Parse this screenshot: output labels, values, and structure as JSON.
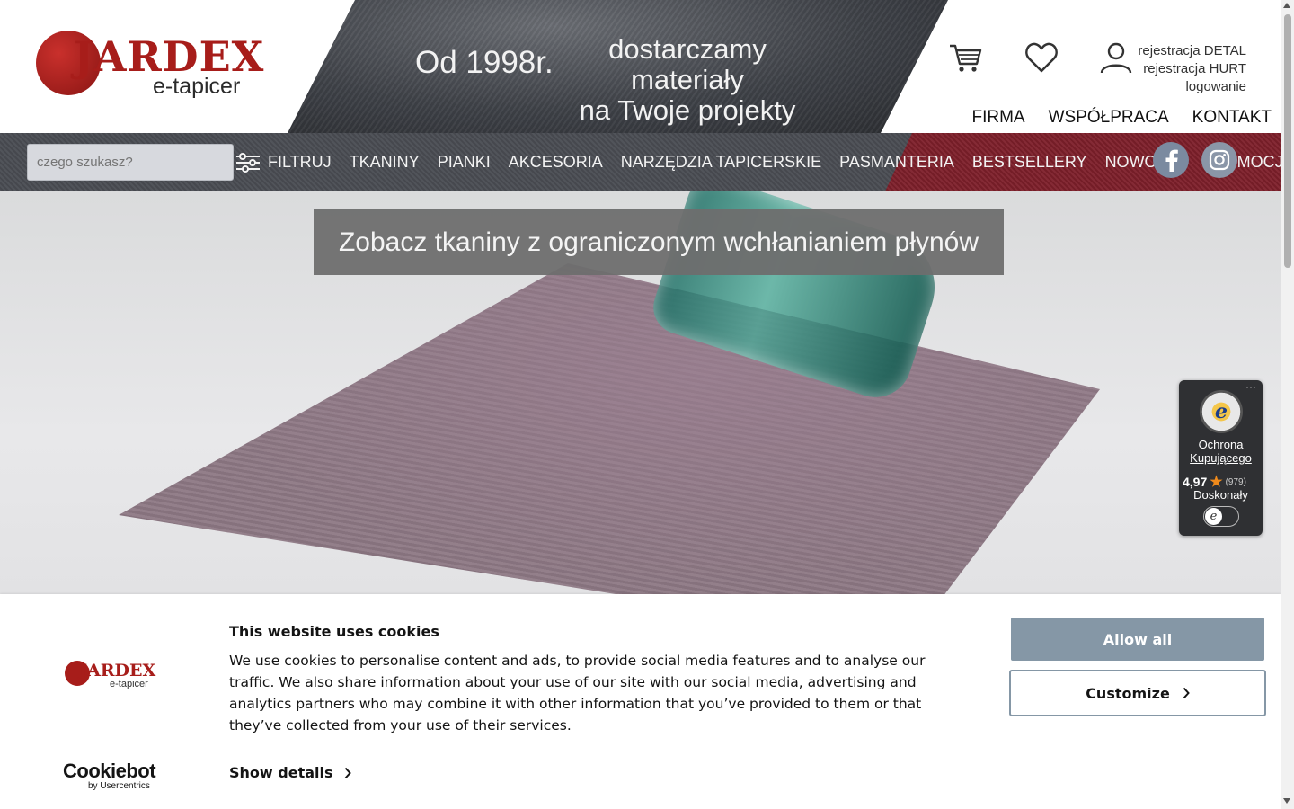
{
  "header": {
    "logo": {
      "word": "JARDEX",
      "sub": "e-tapicer"
    },
    "since": "Od 1998r.",
    "claim_line1": "dostarczamy materiały",
    "claim_line2": "na Twoje projekty",
    "icons": {
      "cart": "cart-icon",
      "wishlist": "heart-icon",
      "account": "user-icon"
    },
    "account_links": [
      "rejestracja DETAL",
      "rejestracja HURT",
      "logowanie"
    ],
    "top_menu": [
      "FIRMA",
      "WSPÓŁPRACA",
      "KONTAKT"
    ]
  },
  "nav": {
    "search_placeholder": "czego szukasz?",
    "filter_label": "FILTRUJ",
    "items": [
      "TKANINY",
      "PIANKI",
      "AKCESORIA",
      "NARZĘDZIA TAPICERSKIE",
      "PASMANTERIA",
      "BESTSELLERY",
      "NOWOŚCI",
      "PROMOCJ"
    ],
    "social": [
      "facebook-icon",
      "instagram-icon"
    ]
  },
  "hero": {
    "caption": "Zobacz tkaniny z ograniczonym wchłanianiem płynów"
  },
  "trusted_shops": {
    "label_line1": "Ochrona",
    "label_line2": "Kupującego",
    "rating": "4,97",
    "count": "(979)",
    "grade": "Doskonały",
    "more": "···",
    "seal_letter": "e"
  },
  "cookie_banner": {
    "logo": {
      "word": "JARDEX",
      "sub": "e-tapicer"
    },
    "title": "This website uses cookies",
    "text": "We use cookies to personalise content and ads, to provide social media features and to analyse our traffic. We also share information about your use of our site with our social media, advertising and analytics partners who may combine it with other information that you’ve provided to them or that they’ve collected from your use of their services.",
    "show_details": "Show details",
    "allow_all": "Allow all",
    "customize": "Customize",
    "provider_name": "Cookiebot",
    "provider_by": "by Usercentrics"
  },
  "colors": {
    "brand_red": "#a71d1a",
    "nav_grey": "#4a4d53",
    "nav_red": "#7e1f2a",
    "cookie_button": "#8597a6"
  }
}
